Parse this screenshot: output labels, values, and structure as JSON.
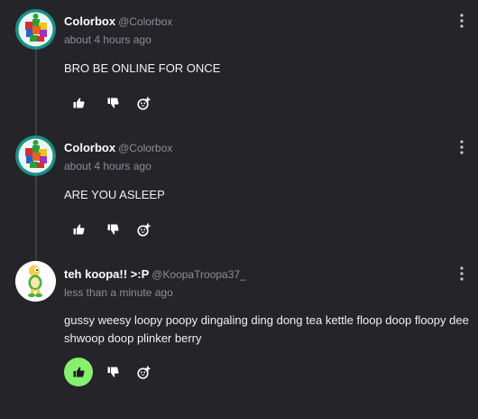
{
  "accent_color": "#86f06e",
  "posts": [
    {
      "display_name": "Colorbox",
      "handle": "@Colorbox",
      "timestamp": "about 4 hours ago",
      "text": "BRO BE ONLINE FOR ONCE",
      "liked": false,
      "avatar": "colorbox-avatar"
    },
    {
      "display_name": "Colorbox",
      "handle": "@Colorbox",
      "timestamp": "about 4 hours ago",
      "text": "ARE YOU ASLEEP",
      "liked": false,
      "avatar": "colorbox-avatar"
    },
    {
      "display_name": "teh koopa!! >:P",
      "handle": "@KoopaTroopa37_",
      "timestamp": "less than a minute ago",
      "text": "gussy weesy loopy poopy dingaling ding dong tea kettle floop doop floopy dee shwoop doop plinker berry",
      "liked": true,
      "avatar": "koopa-avatar"
    }
  ],
  "icons": {
    "like": "thumbs-up-icon",
    "dislike": "thumbs-down-icon",
    "react": "add-reaction-icon",
    "more": "more-vertical-icon"
  }
}
